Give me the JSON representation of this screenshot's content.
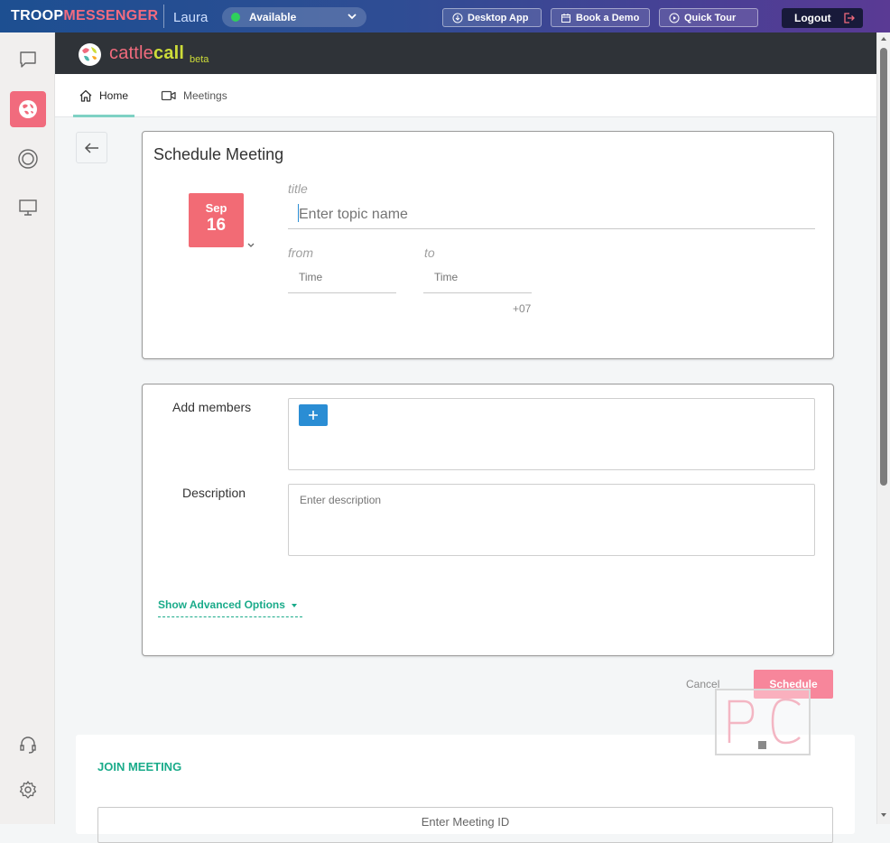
{
  "topbar": {
    "brand_part1": "TROOP",
    "brand_part2": "MESSENGER",
    "user_name": "Laura",
    "status": "Available",
    "desktop_app": "Desktop App",
    "book_demo": "Book a Demo",
    "quick_tour": "Quick Tour",
    "logout": "Logout"
  },
  "app": {
    "logo_part1": "cattle",
    "logo_part2": "call",
    "logo_beta": "beta"
  },
  "tabs": {
    "home": "Home",
    "meetings": "Meetings"
  },
  "schedule_form": {
    "title": "Schedule Meeting",
    "date_month": "Sep",
    "date_day": "16",
    "title_label": "title",
    "topic_placeholder": "Enter topic name",
    "from_label": "from",
    "to_label": "to",
    "from_placeholder": "Time",
    "to_placeholder": "Time",
    "timezone": "+07"
  },
  "details_form": {
    "add_members_label": "Add members",
    "description_label": "Description",
    "description_placeholder": "Enter description",
    "advanced_options": "Show Advanced Options"
  },
  "actions": {
    "cancel": "Cancel",
    "schedule": "Schedule"
  },
  "join": {
    "title": "JOIN MEETING",
    "placeholder": "Enter Meeting ID"
  },
  "colors": {
    "accent_pink": "#f26b75",
    "accent_teal": "#1aab8a",
    "accent_blue": "#2a8dd4"
  }
}
